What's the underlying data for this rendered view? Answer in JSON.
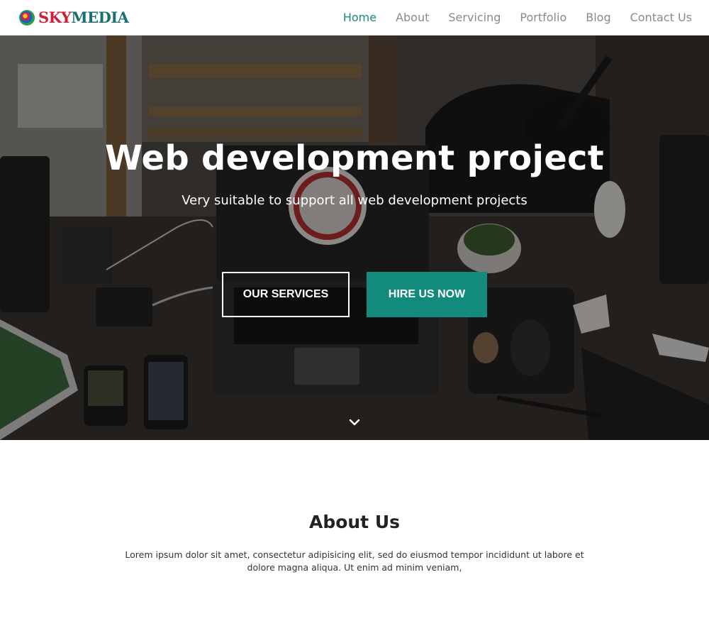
{
  "brand": {
    "prefix": "SKY",
    "suffix": "MEDIA",
    "logo_icon": "swirl-logo-icon"
  },
  "nav": {
    "items": [
      {
        "label": "Home",
        "active": true
      },
      {
        "label": "About",
        "active": false
      },
      {
        "label": "Servicing",
        "active": false
      },
      {
        "label": "Portfolio",
        "active": false
      },
      {
        "label": "Blog",
        "active": false
      },
      {
        "label": "Contact Us",
        "active": false
      }
    ]
  },
  "hero": {
    "title": "Web development project",
    "subtitle": "Very suitable to support all web development projects",
    "primary_button": "OUR SERVICES",
    "secondary_button": "HIRE US NOW",
    "scroll_icon": "chevron-down-icon"
  },
  "about": {
    "title": "About Us",
    "text": "Lorem ipsum dolor sit amet, consectetur adipisicing elit, sed do eiusmod tempor incididunt ut labore et dolore magna aliqua. Ut enim ad minim veniam,"
  },
  "colors": {
    "accent": "#128a7c",
    "nav_active": "#1a8a7e",
    "nav_inactive": "#8a8a8a",
    "logo_teal": "#1b6e6e",
    "logo_red": "#cc1f3a"
  }
}
